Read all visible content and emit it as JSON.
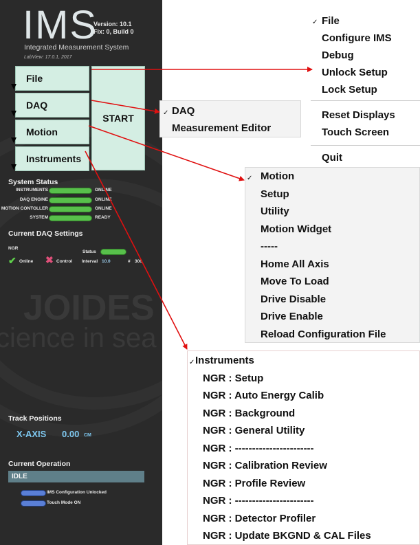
{
  "app": {
    "logo": "IMS",
    "version": "Version: 10.1",
    "fix": "Fix: 0, Build 0",
    "subtitle": "Integrated Measurement System",
    "labview": "LabView: 17.0.1, 2017"
  },
  "panel_buttons": {
    "file": "File",
    "daq": "DAQ",
    "motion": "Motion",
    "instruments": "Instruments",
    "start": "START"
  },
  "watermark": {
    "line1": "JOIDES",
    "line2": "cience in sea"
  },
  "system_status": {
    "title": "System Status",
    "rows": [
      {
        "label": "INSTRUMENTS",
        "value": "ONLINE"
      },
      {
        "label": "DAQ ENGINE",
        "value": "ONLINE"
      },
      {
        "label": "MOTION CONTOLLER",
        "value": "ONLINE"
      },
      {
        "label": "SYSTEM",
        "value": "READY"
      }
    ]
  },
  "daq_settings": {
    "title": "Current DAQ Settings",
    "instrument": "NGR",
    "status_label": "Status",
    "online_label": "Online",
    "control_label": "Control",
    "interval_label": "Interval",
    "interval_value": "10.0",
    "count_label": "#",
    "count_value": "300"
  },
  "track": {
    "title": "Track Positions",
    "axis": "X-AXIS",
    "value": "0.00",
    "unit": "CM"
  },
  "operation": {
    "title": "Current Operation",
    "value": "IDLE",
    "toggles": [
      "IMS Configuration Unlocked",
      "Touch Mode ON"
    ]
  },
  "menus": {
    "file": {
      "items": [
        "File",
        "Configure IMS",
        "Debug",
        "Unlock Setup",
        "Lock Setup",
        "Reset Displays",
        "Touch Screen",
        "Quit"
      ]
    },
    "daq": {
      "items": [
        "DAQ",
        "Measurement Editor"
      ]
    },
    "motion": {
      "items": [
        "Motion",
        "Setup",
        "Utility",
        "Motion Widget",
        "-----",
        "Home All Axis",
        "Move To Load",
        "Drive Disable",
        "Drive Enable",
        "Reload Configuration File"
      ]
    },
    "instruments": {
      "items": [
        "Instruments",
        "NGR :  Setup",
        "NGR :  Auto Energy Calib",
        "NGR :  Background",
        "NGR :  General Utility",
        "NGR :  -----------------------",
        "NGR :  Calibration Review",
        "NGR :  Profile Review",
        "NGR :  -----------------------",
        "NGR :  Detector Profiler",
        "NGR :  Update BKGND & CAL Files"
      ]
    }
  },
  "colors": {
    "panel_bg": "#2a2a2a",
    "button_bg": "#d4eee3",
    "led_green": "#58c04b",
    "toggle_blue": "#5a7fd6",
    "arrow_red": "#e01010",
    "axis_text": "#7ec8f0"
  }
}
